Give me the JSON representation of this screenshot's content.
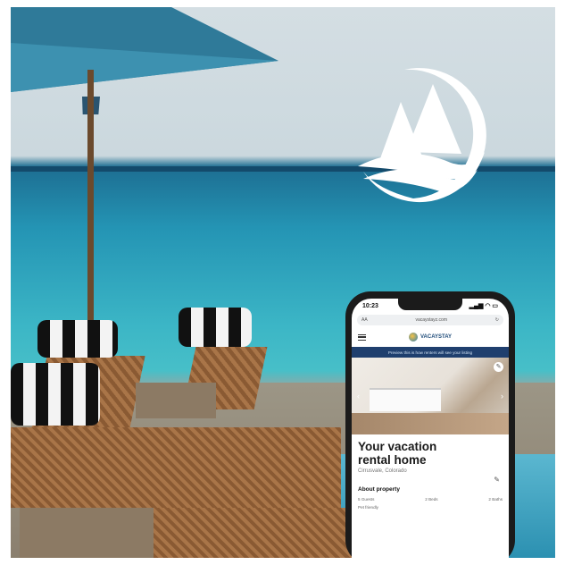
{
  "phone": {
    "status_time": "10:23",
    "status_icons": "▂▄▆ ◠ ▭",
    "url": "vacaystayz.com",
    "url_prefix": "AA",
    "reload_icon": "↻",
    "brand_name": "VACAYSTAY",
    "banner_text": "Preview this is how renters will see your listing",
    "listing_title": "Your vacation rental home",
    "listing_location": "Cirrusvale, Colorado",
    "about_heading": "About property",
    "stats": [
      "5 Guests",
      "2 Beds",
      "2 Baths"
    ],
    "pets": "Pet friendly",
    "edit_icon": "✎",
    "arrow_left": "‹",
    "arrow_right": "›"
  },
  "colors": {
    "brand_navy": "#1f3f6e",
    "ocean": "#2494b4"
  }
}
